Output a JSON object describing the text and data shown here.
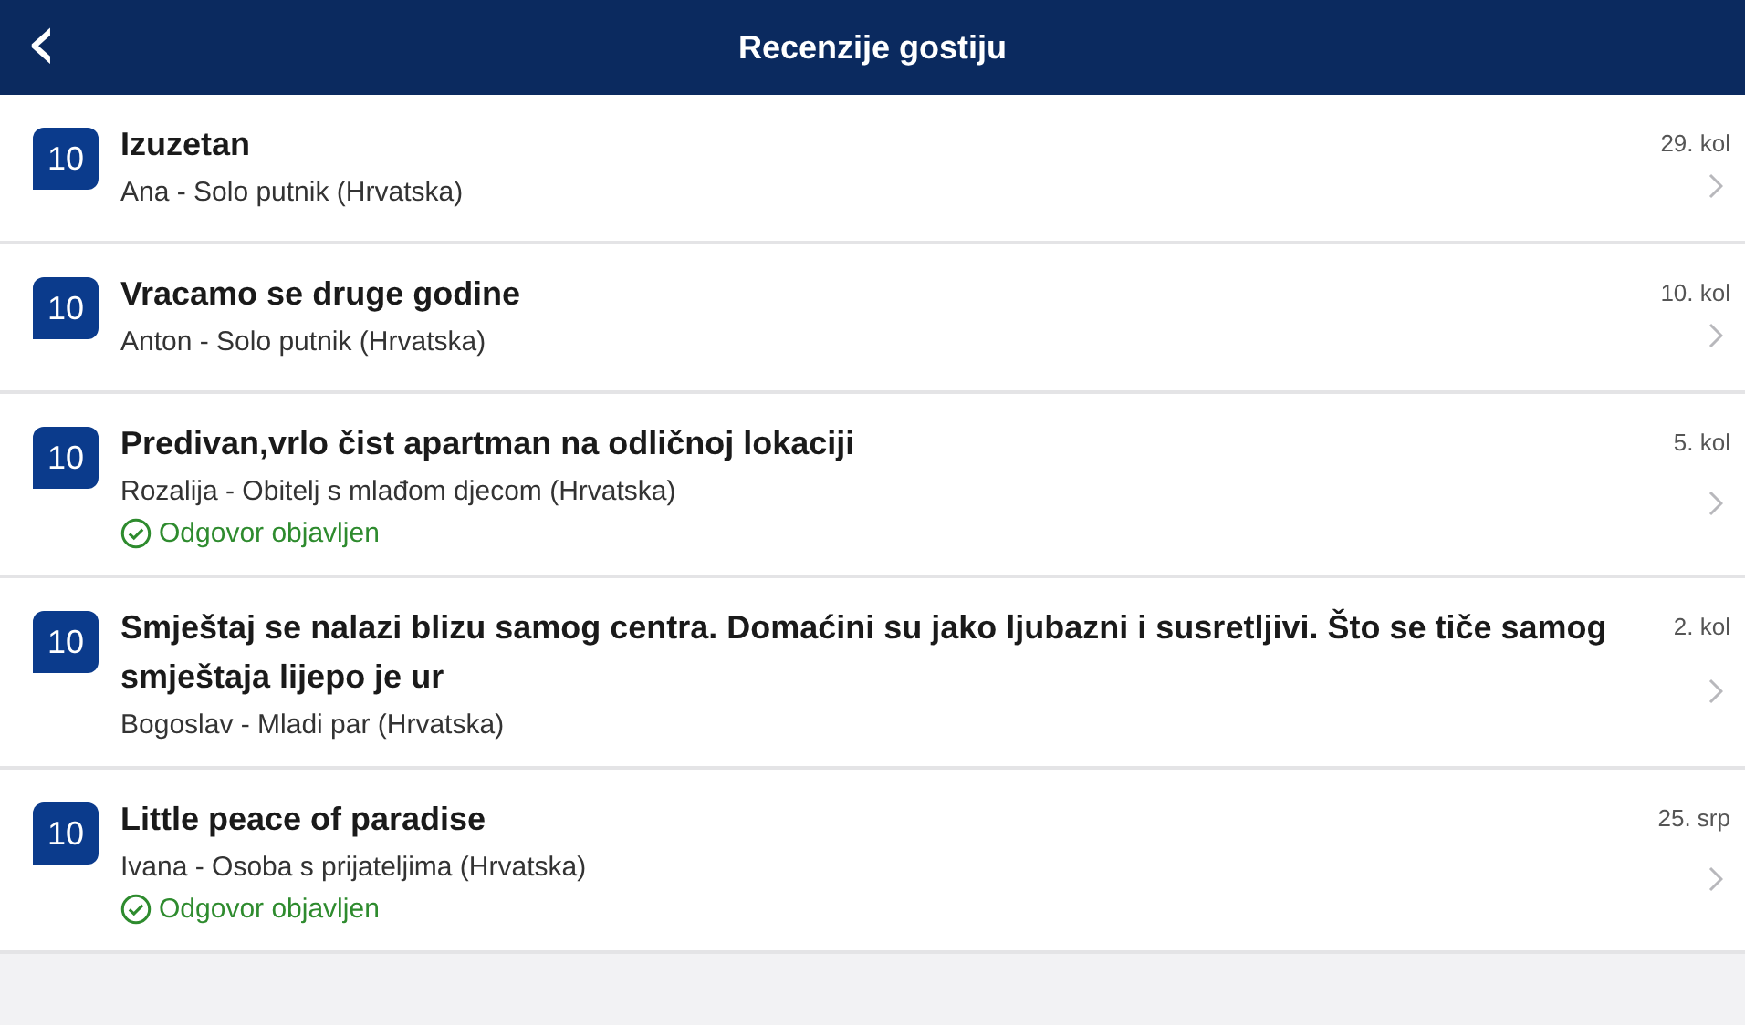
{
  "header": {
    "back": "‹",
    "title": "Recenzije gostiju"
  },
  "reviews": [
    {
      "score": "10",
      "title": "Izuzetan",
      "author": "Ana - Solo putnik (Hrvatska)",
      "date": "29. kol"
    },
    {
      "score": "10",
      "title": "Vracamo se druge godine",
      "author": "Anton - Solo putnik (Hrvatska)",
      "date": "10. kol"
    },
    {
      "score": "10",
      "title": "Predivan,vrlo čist apartman na odličnoj lokaciji",
      "author": "Rozalija - Obitelj s mlađom djecom (Hrvatska)",
      "date": "5. kol",
      "reply": "Odgovor objavljen"
    },
    {
      "score": "10",
      "title": "Smještaj se nalazi blizu samog centra. Domaćini su jako ljubazni i susretljivi. Što se tiče samog smještaja lijepo je ur",
      "author": "Bogoslav - Mladi par (Hrvatska)",
      "date": "2. kol"
    },
    {
      "score": "10",
      "title": "Little peace of paradise",
      "author": "Ivana - Osoba s prijateljima (Hrvatska)",
      "date": "25. srp",
      "reply": "Odgovor objavljen"
    }
  ]
}
